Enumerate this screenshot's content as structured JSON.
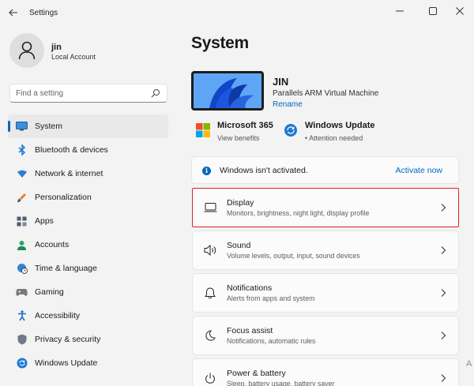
{
  "window": {
    "title": "Settings",
    "controls": [
      "minimize-icon",
      "maximize-icon",
      "close-icon"
    ]
  },
  "profile": {
    "name": "jin",
    "account_type": "Local Account"
  },
  "search": {
    "placeholder": "Find a setting"
  },
  "nav": {
    "items": [
      {
        "label": "System",
        "icon": "monitor-icon",
        "active": true
      },
      {
        "label": "Bluetooth & devices",
        "icon": "bluetooth-icon"
      },
      {
        "label": "Network & internet",
        "icon": "wifi-icon"
      },
      {
        "label": "Personalization",
        "icon": "brush-icon"
      },
      {
        "label": "Apps",
        "icon": "apps-icon"
      },
      {
        "label": "Accounts",
        "icon": "person-icon"
      },
      {
        "label": "Time & language",
        "icon": "globe-clock-icon"
      },
      {
        "label": "Gaming",
        "icon": "gamepad-icon"
      },
      {
        "label": "Accessibility",
        "icon": "accessibility-icon"
      },
      {
        "label": "Privacy & security",
        "icon": "shield-icon"
      },
      {
        "label": "Windows Update",
        "icon": "update-icon"
      }
    ]
  },
  "main": {
    "title": "System",
    "device": {
      "name": "JIN",
      "model": "Parallels ARM Virtual Machine",
      "rename": "Rename"
    },
    "quick_links": [
      {
        "title": "Microsoft 365",
        "subtitle": "View benefits",
        "icon": "microsoft-logo-icon"
      },
      {
        "title": "Windows Update",
        "subtitle": "• Attention needed",
        "icon": "update-icon"
      }
    ],
    "activation": {
      "text": "Windows isn't activated.",
      "link": "Activate now"
    },
    "cards": [
      {
        "title": "Display",
        "subtitle": "Monitors, brightness, night light, display profile",
        "icon": "display-icon",
        "selected": true
      },
      {
        "title": "Sound",
        "subtitle": "Volume levels, output, input, sound devices",
        "icon": "speaker-icon"
      },
      {
        "title": "Notifications",
        "subtitle": "Alerts from apps and system",
        "icon": "bell-icon"
      },
      {
        "title": "Focus assist",
        "subtitle": "Notifications, automatic rules",
        "icon": "moon-icon"
      },
      {
        "title": "Power & battery",
        "subtitle": "Sleep, battery usage, battery saver",
        "icon": "power-icon"
      }
    ]
  },
  "colors": {
    "accent": "#0067c0",
    "selection_border": "#e02020",
    "background": "#f3f3f3"
  }
}
